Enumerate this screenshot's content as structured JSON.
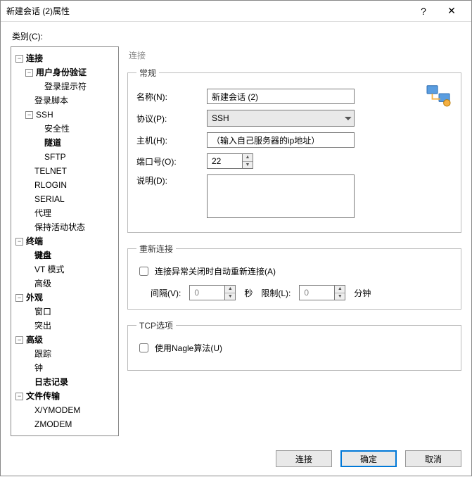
{
  "window": {
    "title": "新建会话 (2)属性",
    "help": "?",
    "close": "✕"
  },
  "category_label": "类别(C):",
  "tree": {
    "conn": "连接",
    "auth": "用户身份验证",
    "loginprompt": "登录提示符",
    "loginscript": "登录脚本",
    "ssh": "SSH",
    "security": "安全性",
    "tunnel": "隧道",
    "sftp": "SFTP",
    "telnet": "TELNET",
    "rlogin": "RLOGIN",
    "serial": "SERIAL",
    "proxy": "代理",
    "keepalive": "保持活动状态",
    "terminal": "终端",
    "keyboard": "键盘",
    "vtmode": "VT 模式",
    "adv1": "高级",
    "appearance": "外观",
    "window": "窗口",
    "highlight": "突出",
    "advanced": "高级",
    "trace": "跟踪",
    "bell": "钟",
    "logging": "日志记录",
    "filetrans": "文件传输",
    "xymodem": "X/YMODEM",
    "zmodem": "ZMODEM"
  },
  "section_title": "连接",
  "general": {
    "legend": "常规",
    "name_label": "名称(N):",
    "name_value": "新建会话 (2)",
    "proto_label": "协议(P):",
    "proto_value": "SSH",
    "host_label": "主机(H):",
    "host_value": "（输入自己服务器的ip地址）",
    "port_label": "端口号(O):",
    "port_value": "22",
    "desc_label": "说明(D):",
    "desc_value": ""
  },
  "reconnect": {
    "legend": "重新连接",
    "checkbox": "连接异常关闭时自动重新连接(A)",
    "interval_label": "间隔(V):",
    "interval_value": "0",
    "interval_unit": "秒",
    "limit_label": "限制(L):",
    "limit_value": "0",
    "limit_unit": "分钟"
  },
  "tcp": {
    "legend": "TCP选项",
    "nagle": "使用Nagle算法(U)"
  },
  "buttons": {
    "connect": "连接",
    "ok": "确定",
    "cancel": "取消"
  }
}
